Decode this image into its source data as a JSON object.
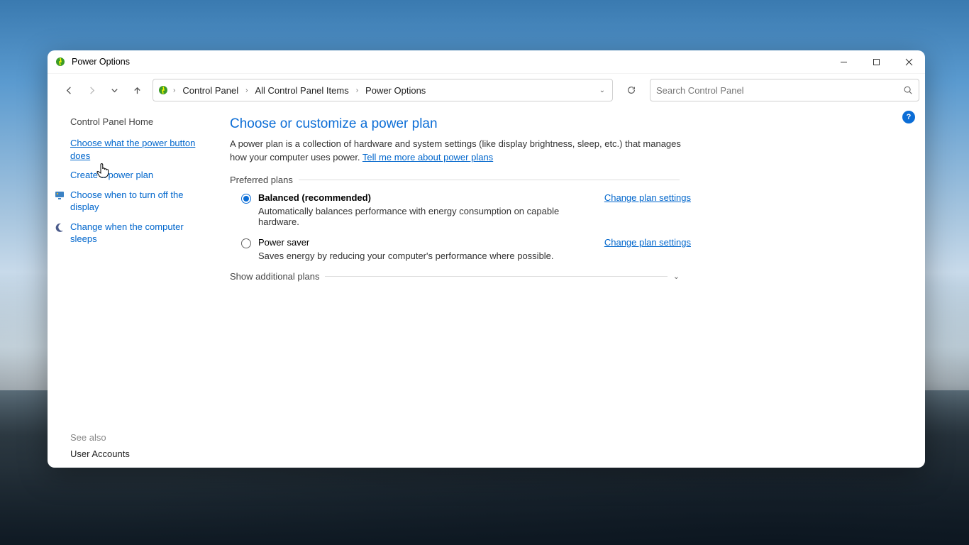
{
  "window": {
    "title": "Power Options"
  },
  "breadcrumb": {
    "items": [
      "Control Panel",
      "All Control Panel Items",
      "Power Options"
    ]
  },
  "search": {
    "placeholder": "Search Control Panel"
  },
  "sidebar": {
    "home": "Control Panel Home",
    "links": [
      {
        "label": "Choose what the power button does",
        "current": true
      },
      {
        "label": "Create a power plan"
      },
      {
        "label": "Choose when to turn off the display",
        "icon": "display"
      },
      {
        "label": "Change when the computer sleeps",
        "icon": "moon"
      }
    ],
    "see_also_heading": "See also",
    "see_also": [
      "User Accounts"
    ]
  },
  "main": {
    "title": "Choose or customize a power plan",
    "description": "A power plan is a collection of hardware and system settings (like display brightness, sleep, etc.) that manages how your computer uses power. ",
    "learn_more": "Tell me more about power plans",
    "preferred_label": "Preferred plans",
    "plans": [
      {
        "name": "Balanced (recommended)",
        "desc": "Automatically balances performance with energy consumption on capable hardware.",
        "selected": true,
        "change_label": "Change plan settings"
      },
      {
        "name": "Power saver",
        "desc": "Saves energy by reducing your computer's performance where possible.",
        "selected": false,
        "change_label": "Change plan settings"
      }
    ],
    "show_additional": "Show additional plans"
  },
  "help_badge": "?"
}
